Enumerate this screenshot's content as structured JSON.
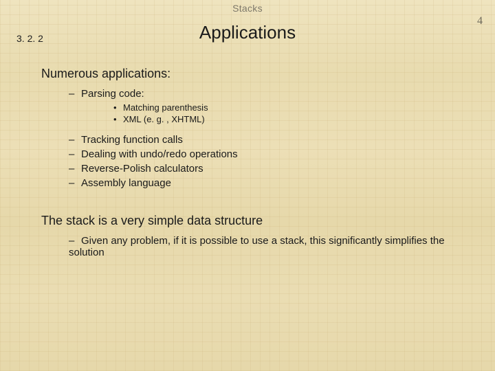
{
  "header": {
    "topic": "Stacks",
    "page_number": "4",
    "section_number": "3. 2. 2",
    "title": "Applications"
  },
  "body": {
    "intro": "Numerous applications:",
    "item1": {
      "label": "Parsing code:"
    },
    "item1_sub": {
      "a": "Matching parenthesis",
      "b": "XML (e. g. , XHTML)"
    },
    "item2": "Tracking function calls",
    "item3": "Dealing with undo/redo operations",
    "item4": "Reverse-Polish calculators",
    "item5": "Assembly language",
    "para2": "The stack is a very simple data structure",
    "para2_sub": "Given any problem, if it is possible to use a stack, this significantly simplifies the solution"
  }
}
